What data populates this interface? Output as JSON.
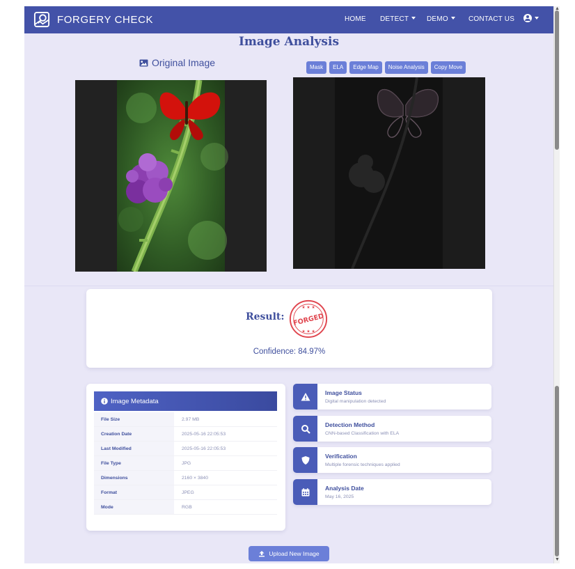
{
  "navbar": {
    "brand": "FORGERY CHECK",
    "items": [
      {
        "label": "HOME"
      },
      {
        "label": "DETECT"
      },
      {
        "label": "DEMO"
      },
      {
        "label": "CONTACT US"
      }
    ]
  },
  "page_title": "Image Analysis",
  "original_image": {
    "heading": "Original Image"
  },
  "analysis_tabs": [
    "Mask",
    "ELA",
    "Edge Map",
    "Noise Analysis",
    "Copy Move"
  ],
  "result": {
    "label": "Result:",
    "stamp_text": "FORGED",
    "confidence": "Confidence: 84.97%"
  },
  "metadata": {
    "title": "Image Metadata",
    "rows": [
      {
        "key": "File Size",
        "value": "2.97 MB"
      },
      {
        "key": "Creation Date",
        "value": "2025-05-16 22:05:53"
      },
      {
        "key": "Last Modified",
        "value": "2025-05-16 22:05:53"
      },
      {
        "key": "File Type",
        "value": "JPG"
      },
      {
        "key": "Dimensions",
        "value": "2160 × 3840"
      },
      {
        "key": "Format",
        "value": "JPEG"
      },
      {
        "key": "Mode",
        "value": "RGB"
      }
    ]
  },
  "status_cards": [
    {
      "icon": "warning-icon",
      "title": "Image Status",
      "desc": "Digital manipulation detected"
    },
    {
      "icon": "search-icon",
      "title": "Detection Method",
      "desc": "CNN-based Classification with ELA"
    },
    {
      "icon": "shield-icon",
      "title": "Verification",
      "desc": "Multiple forensic techniques applied"
    },
    {
      "icon": "calendar-icon",
      "title": "Analysis Date",
      "desc": "May 16, 2025"
    }
  ],
  "upload_button": "Upload New Image",
  "colors": {
    "navbar": "#4352a8",
    "page_bg": "#e9e7f7",
    "accent_button": "#6b7fd8",
    "heading": "#3f4f9d",
    "stamp_red": "#e0464f"
  }
}
